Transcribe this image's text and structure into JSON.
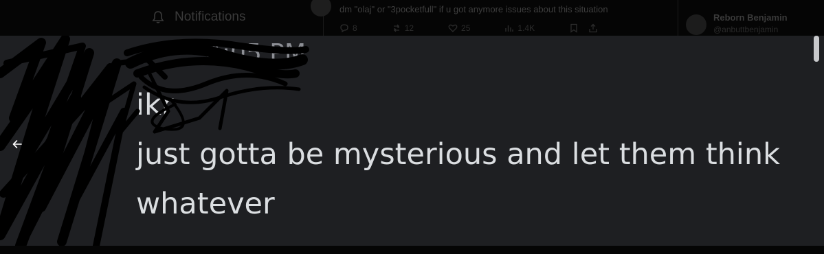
{
  "background": {
    "nav_item": {
      "label": "Notifications",
      "icon": "bell-icon"
    },
    "post": {
      "text": "dm \"olaj\" or \"3pocketfull\" if u got anymore issues about this situation",
      "actions": [
        {
          "icon": "reply-icon",
          "count": "8"
        },
        {
          "icon": "repost-icon",
          "count": "12"
        },
        {
          "icon": "like-icon",
          "count": "25"
        },
        {
          "icon": "views-icon",
          "count": "1.4K"
        },
        {
          "icon": "bookmark-icon",
          "count": ""
        },
        {
          "icon": "share-icon",
          "count": ""
        }
      ]
    },
    "profile": {
      "name": "Reborn Benjamin",
      "handle": "@anbuttbenjamin"
    }
  },
  "viewer": {
    "back_icon": "arrow-left-icon",
    "timestamp": "4:05 PM",
    "message_lines": [
      "ikr",
      "just gotta be mysterious and let them think",
      "whatever"
    ],
    "colors": {
      "panel": "#1e1f22",
      "message_text": "#dbdee1",
      "timestamp_text": "#8d8f95",
      "scribble": "#000000"
    }
  }
}
